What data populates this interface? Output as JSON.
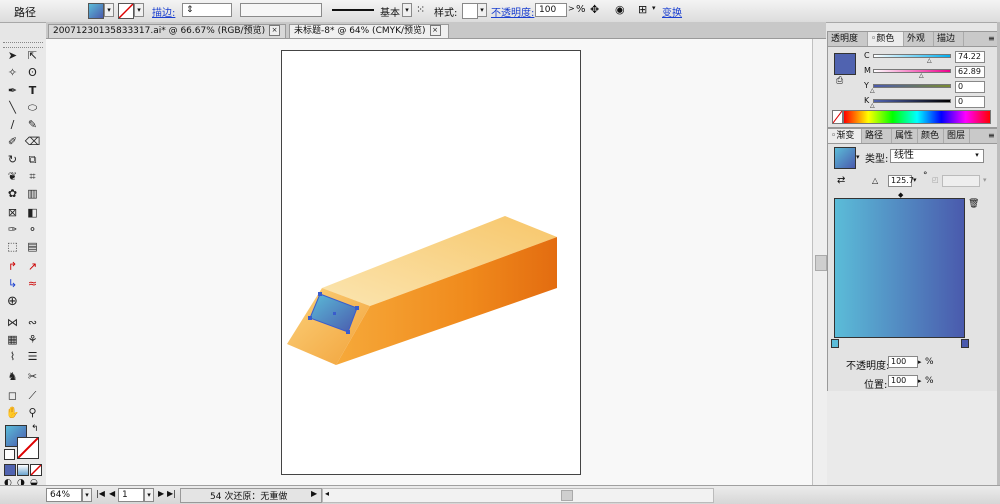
{
  "control_bar": {
    "object_type": "路径",
    "stroke_label": "描边:",
    "stroke_line_label": "基本",
    "style_label": "样式:",
    "opacity_label": "不透明度:",
    "opacity_value": "100",
    "percent": "%",
    "transform_label": "变换"
  },
  "doc_tabs": [
    {
      "label": "20071230135833317.ai* @ 66.67% (RGB/预览)",
      "active": false
    },
    {
      "label": "未标题-8* @ 64% (CMYK/预览)",
      "active": true
    }
  ],
  "color_panel": {
    "tabs": [
      "透明度",
      "颜色",
      "外观",
      "描边"
    ],
    "active_tab": "颜色",
    "channels": [
      {
        "name": "C",
        "value": "74.22",
        "fraction": 0.7422
      },
      {
        "name": "M",
        "value": "62.89",
        "fraction": 0.6289
      },
      {
        "name": "Y",
        "value": "0",
        "fraction": 0
      },
      {
        "name": "K",
        "value": "0",
        "fraction": 0
      }
    ],
    "fill_color": "#5063b0"
  },
  "gradient_panel": {
    "tabs": [
      "渐变",
      "路径",
      "属性",
      "颜色",
      "图层"
    ],
    "active_tab": "渐变",
    "type_label": "类型:",
    "type_value": "线性",
    "angle_value": "125.7",
    "degree": "°",
    "start_color": "#5bbcd8",
    "end_color": "#4a5aad",
    "opacity_label": "不透明度:",
    "opacity_value": "100",
    "location_label": "位置:",
    "location_value": "100",
    "percent": "%"
  },
  "status_bar": {
    "zoom": "64%",
    "page": "1",
    "message": "54 次还原：无重做"
  },
  "colors": {
    "accent_link": "#1a3fd0",
    "pencil_light": "#fbe2a6",
    "pencil_orange": "#f08a1c"
  }
}
